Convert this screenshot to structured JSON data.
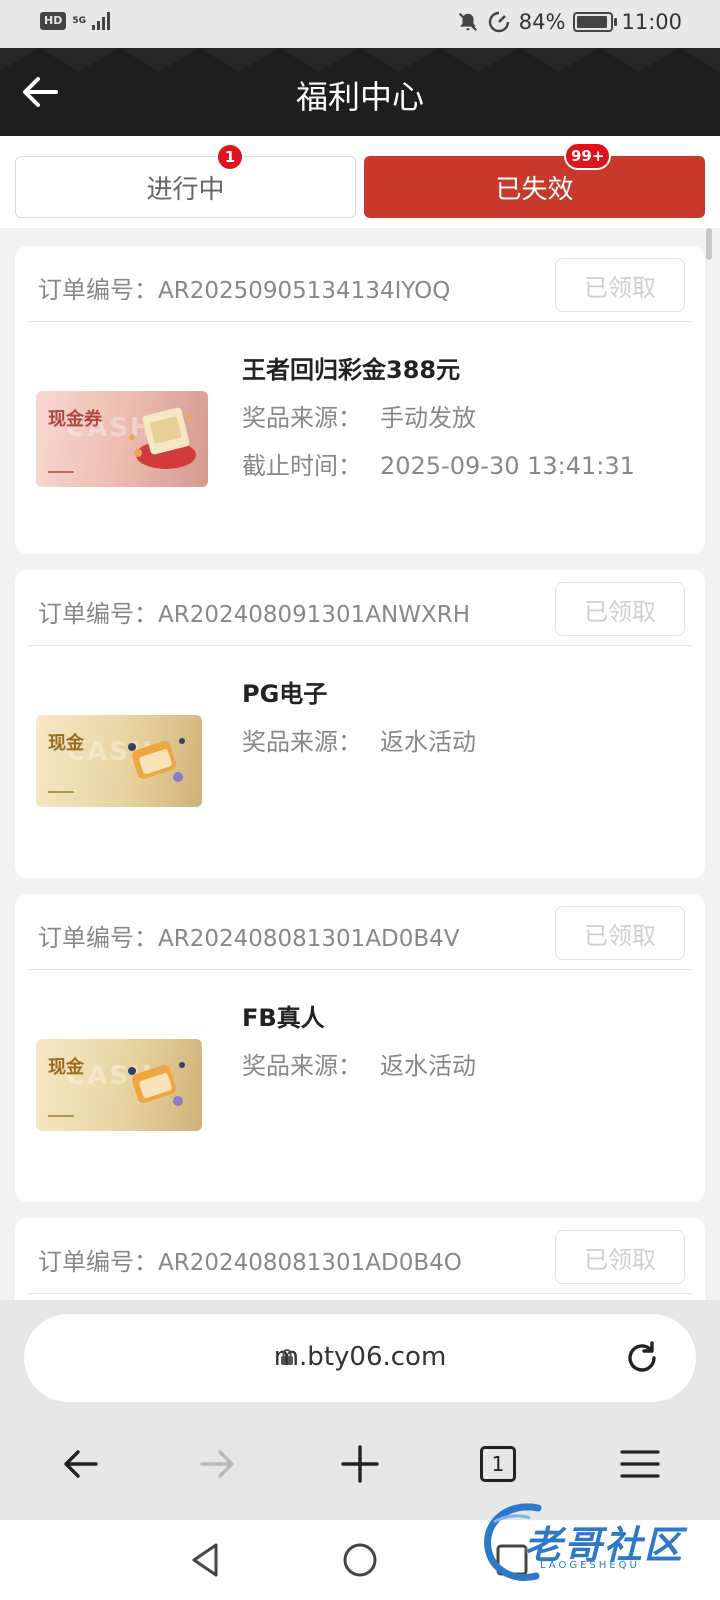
{
  "status_bar": {
    "network_badge": "HD",
    "network_type": "5G",
    "battery_percent": "84%",
    "battery_level": 0.84,
    "time": "11:00",
    "icons": [
      "mute-icon",
      "data-saver-icon",
      "battery-icon"
    ]
  },
  "header": {
    "title": "福利中心",
    "back_icon": "back-arrow-icon"
  },
  "tabs": [
    {
      "label": "进行中",
      "badge": "1",
      "active": false
    },
    {
      "label": "已失效",
      "badge": "99+",
      "active": true
    }
  ],
  "cards": [
    {
      "order_label": "订单编号：",
      "order_no": "AR20250905134134IYOQ",
      "status_button": "已领取",
      "thumb_label": "现金券",
      "thumb_watermark": "CASH",
      "title": "王者回归彩金388元",
      "lines": [
        {
          "label": "奖品来源：",
          "value": "手动发放"
        },
        {
          "label": "截止时间：",
          "value": "2025-09-30 13:41:31"
        }
      ]
    },
    {
      "order_label": "订单编号：",
      "order_no": "AR202408091301ANWXRH",
      "status_button": "已领取",
      "thumb_label": "现金",
      "thumb_watermark": "CASH",
      "title": "PG电子",
      "lines": [
        {
          "label": "奖品来源：",
          "value": "返水活动"
        }
      ]
    },
    {
      "order_label": "订单编号：",
      "order_no": "AR202408081301AD0B4V",
      "status_button": "已领取",
      "thumb_label": "现金",
      "thumb_watermark": "CASH",
      "title": "FB真人",
      "lines": [
        {
          "label": "奖品来源：",
          "value": "返水活动"
        }
      ]
    },
    {
      "order_label": "订单编号：",
      "order_no": "AR202408081301AD0B4O",
      "status_button": "已领取"
    }
  ],
  "browser": {
    "url": "m.bty06.com",
    "tab_count": "1"
  },
  "watermark": {
    "text": "老哥社区",
    "sub": "LAOGESHEQU"
  },
  "colors": {
    "accent": "#c8392b",
    "badge": "#e0121e",
    "header_bg": "#1e1e1e"
  }
}
